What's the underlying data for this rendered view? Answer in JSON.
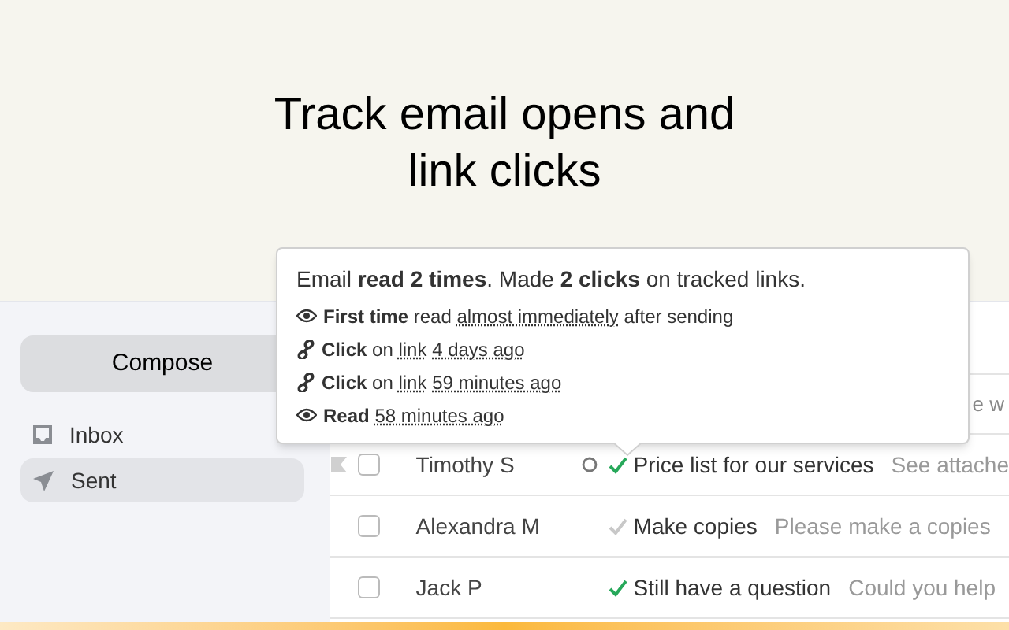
{
  "hero": {
    "title": "Track email opens and link clicks"
  },
  "sidebar": {
    "compose": "Compose",
    "items": [
      {
        "label": "Inbox",
        "selected": false
      },
      {
        "label": "Sent",
        "selected": true
      }
    ]
  },
  "rows": [
    {
      "kind": "partial",
      "preview": "e w"
    },
    {
      "kind": "mail",
      "name": "Timothy S",
      "subject": "Price list for our services",
      "preview": "See attache",
      "flagged": true,
      "circle": true,
      "opened": true,
      "checked": false
    },
    {
      "kind": "mail",
      "name": "Alexandra M",
      "subject": "Make copies",
      "preview": "Please make a copies",
      "flagged": false,
      "circle": false,
      "opened": false,
      "checked": false
    },
    {
      "kind": "mail",
      "name": "Jack P",
      "subject": "Still have a question",
      "preview": "Could you help",
      "flagged": false,
      "circle": false,
      "opened": true,
      "checked": false
    }
  ],
  "tooltip": {
    "summary": "Email **read 2 times**. Made **2 clicks** on tracked links.",
    "lines": [
      {
        "kind": "eye",
        "parts": [
          {
            "kind": "bold",
            "text": "First time"
          },
          {
            "kind": "plain",
            "text": "read"
          },
          {
            "kind": "dotted",
            "text": "almost immediately"
          },
          {
            "kind": "plain",
            "text": "after sending"
          }
        ]
      },
      {
        "kind": "link",
        "parts": [
          {
            "kind": "bold",
            "text": "Click"
          },
          {
            "kind": "plain",
            "text": "on"
          },
          {
            "kind": "dotted",
            "text": "link"
          },
          {
            "kind": "dotted",
            "text": "4 days ago"
          }
        ]
      },
      {
        "kind": "link",
        "parts": [
          {
            "kind": "bold",
            "text": "Click"
          },
          {
            "kind": "plain",
            "text": "on"
          },
          {
            "kind": "dotted",
            "text": "link"
          },
          {
            "kind": "dotted",
            "text": "59 minutes ago"
          }
        ]
      },
      {
        "kind": "eye",
        "parts": [
          {
            "kind": "bold",
            "text": "Read"
          },
          {
            "kind": "dotted",
            "text": "58 minutes ago"
          }
        ]
      }
    ]
  }
}
